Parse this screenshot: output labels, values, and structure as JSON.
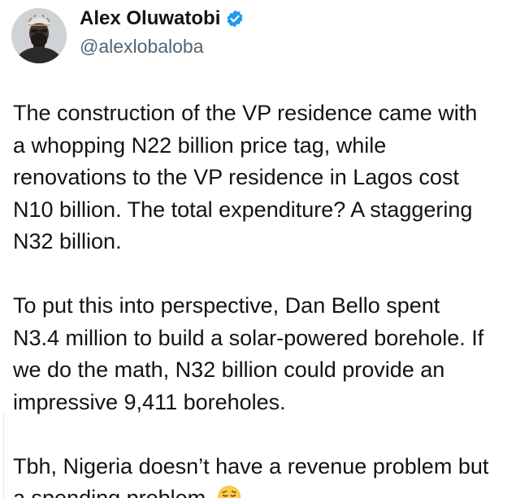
{
  "author": {
    "display_name": "Alex Oluwatobi",
    "handle": "@alexlobaloba",
    "verified": true,
    "verified_color": "#1d9bf0"
  },
  "tweet": {
    "paragraphs": [
      "The construction of the VP residence came with\na whopping N22 billion price tag, while\nrenovations to the VP residence in Lagos cost\nN10 billion. The total expenditure? A staggering\nN32 billion.",
      "To put this into perspective, Dan Bello spent\nN3.4 million to build a solar-powered borehole. If\nwe do the math, N32 billion could provide an\nimpressive 9,411 boreholes.",
      "Tbh, Nigeria doesn’t have a revenue problem but\na spending problem."
    ],
    "trailing_emoji": "pensive-face-emoji"
  }
}
